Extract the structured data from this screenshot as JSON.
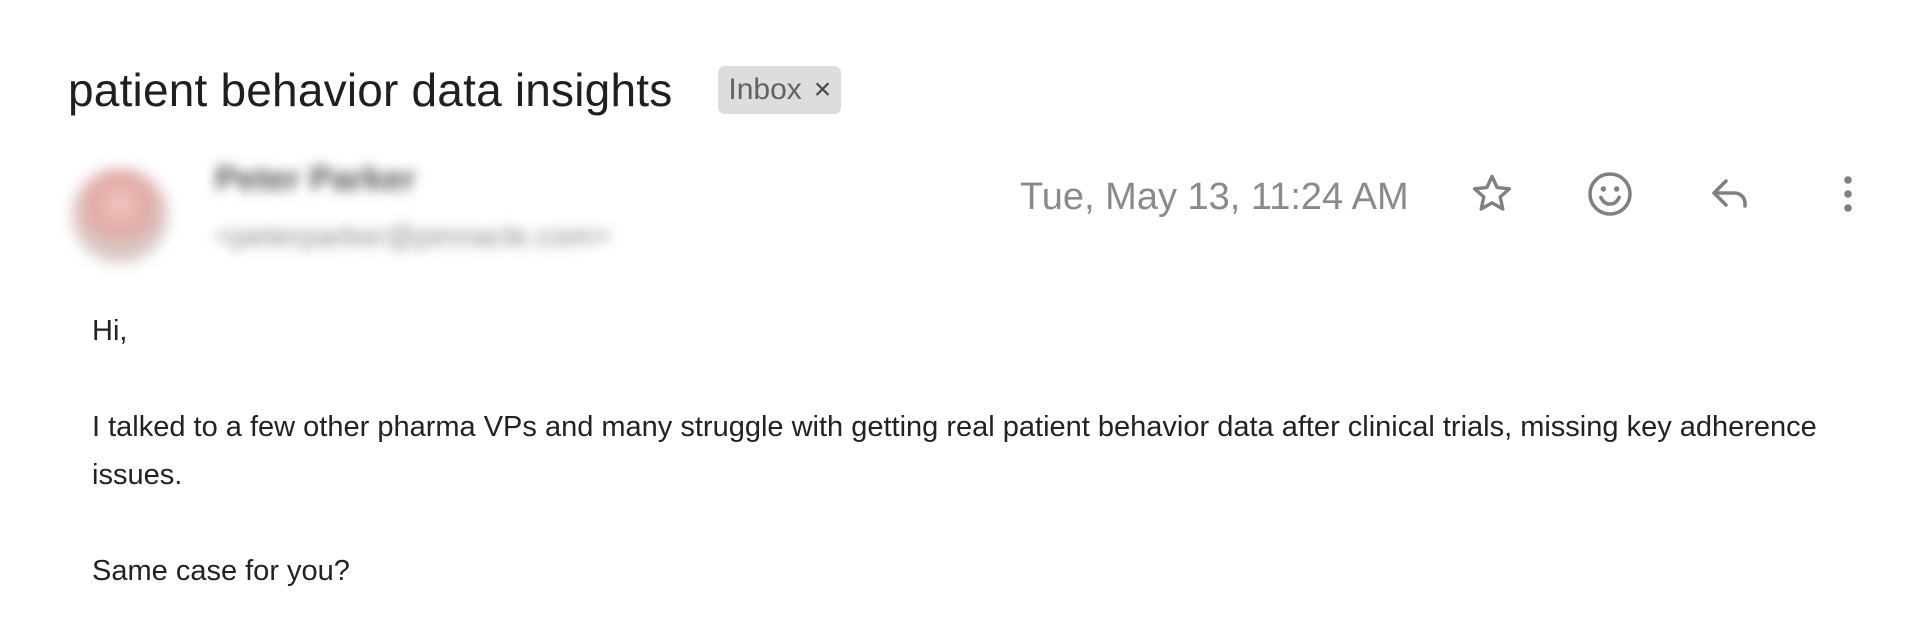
{
  "email": {
    "subject": "patient behavior data insights",
    "label": {
      "name": "Inbox",
      "remove_glyph": "×"
    },
    "sender": {
      "name": "Peter Parker",
      "email": "<peterparker@pinnacle.com>",
      "avatar_icon": "avatar-photo"
    },
    "timestamp": "Tue, May 13, 11:24 AM",
    "actions": {
      "star_icon": "star-icon",
      "emoji_icon": "emoji-reaction-icon",
      "reply_icon": "reply-icon",
      "more_icon": "more-vertical-icon"
    },
    "body": {
      "greeting": "Hi,",
      "paragraph1": "I talked to a few other pharma VPs and many struggle with getting real patient behavior data after clinical trials, missing key adherence issues.",
      "paragraph2": "Same case for you?"
    }
  }
}
